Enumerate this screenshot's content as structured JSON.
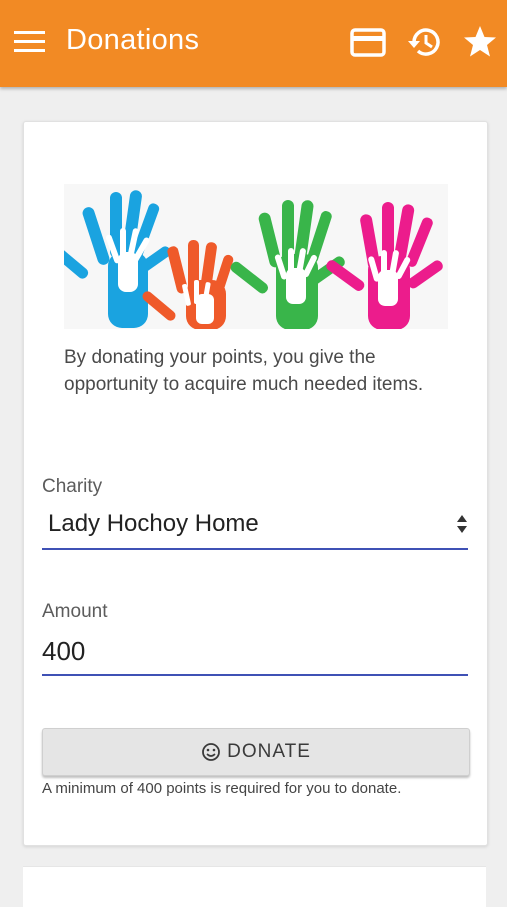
{
  "appbar": {
    "title": "Donations",
    "icons": [
      "menu-icon",
      "credit-card-icon",
      "history-icon",
      "star-icon"
    ]
  },
  "colors": {
    "appbar": "#f28a24",
    "underline": "#3f51b5",
    "hand_blue": "#1aa3e0",
    "hand_orange": "#ef5a2a",
    "hand_green": "#39b54a",
    "hand_pink": "#ec1c8c"
  },
  "main": {
    "intro": "By donating your points, you give the opportunity to acquire much needed items.",
    "charity": {
      "label": "Charity",
      "value": "Lady Hochoy Home"
    },
    "amount": {
      "label": "Amount",
      "value": "400"
    },
    "donate": {
      "label": "DONATE",
      "icon": "smile-icon"
    },
    "hint": "A minimum of 400 points is required for you to donate."
  }
}
